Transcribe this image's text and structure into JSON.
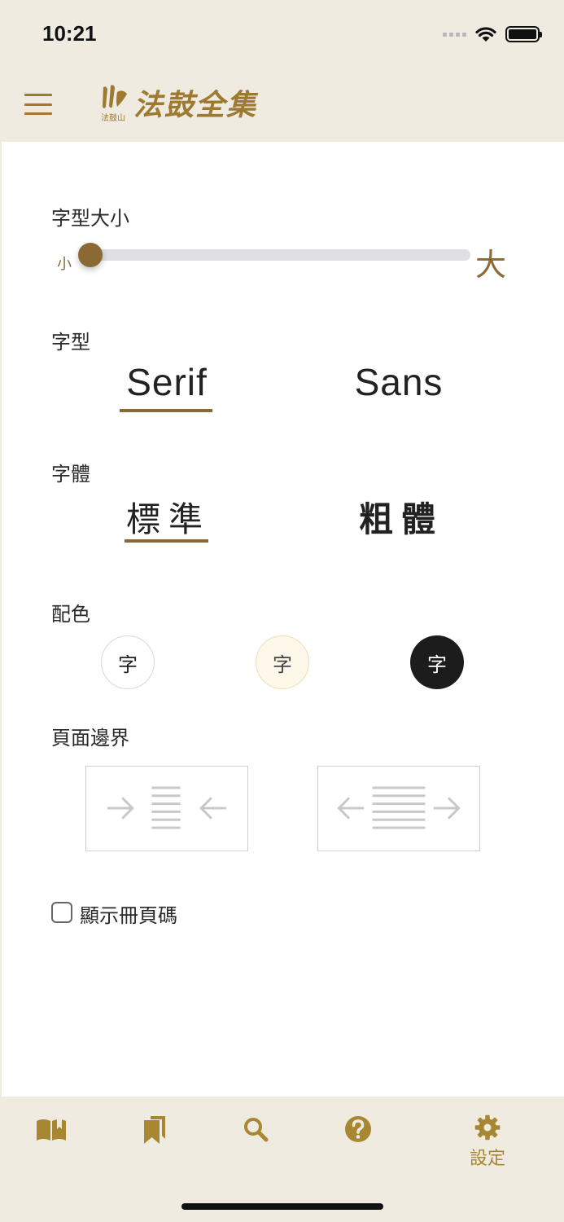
{
  "status_bar": {
    "time": "10:21"
  },
  "header": {
    "logo_text": "法鼓全集",
    "logo_sub": "法鼓山"
  },
  "settings": {
    "font_size": {
      "label": "字型大小",
      "min_label": "小",
      "max_label": "大",
      "level": 0
    },
    "font_family": {
      "label": "字型",
      "options": [
        "Serif",
        "Sans"
      ],
      "selected": "Serif"
    },
    "font_weight": {
      "label": "字體",
      "options": [
        "標準",
        "粗體"
      ],
      "selected": "標準"
    },
    "color_scheme": {
      "label": "配色",
      "swatch_text": "字",
      "options": [
        {
          "name": "white",
          "color": "#ffffff"
        },
        {
          "name": "cream",
          "color": "#fdf8ea"
        },
        {
          "name": "dark",
          "color": "#1c1c1c"
        }
      ]
    },
    "page_margin": {
      "label": "頁面邊界"
    },
    "show_page_numbers": {
      "label": "顯示冊頁碼",
      "checked": false
    }
  },
  "tabbar": {
    "items": [
      {
        "name": "books",
        "label": ""
      },
      {
        "name": "bookmarks",
        "label": ""
      },
      {
        "name": "search",
        "label": ""
      },
      {
        "name": "help",
        "label": ""
      },
      {
        "name": "settings",
        "label": "設定"
      }
    ]
  },
  "colors": {
    "accent": "#8b6934",
    "brand": "#a88733",
    "header_bg": "#efebe0"
  }
}
